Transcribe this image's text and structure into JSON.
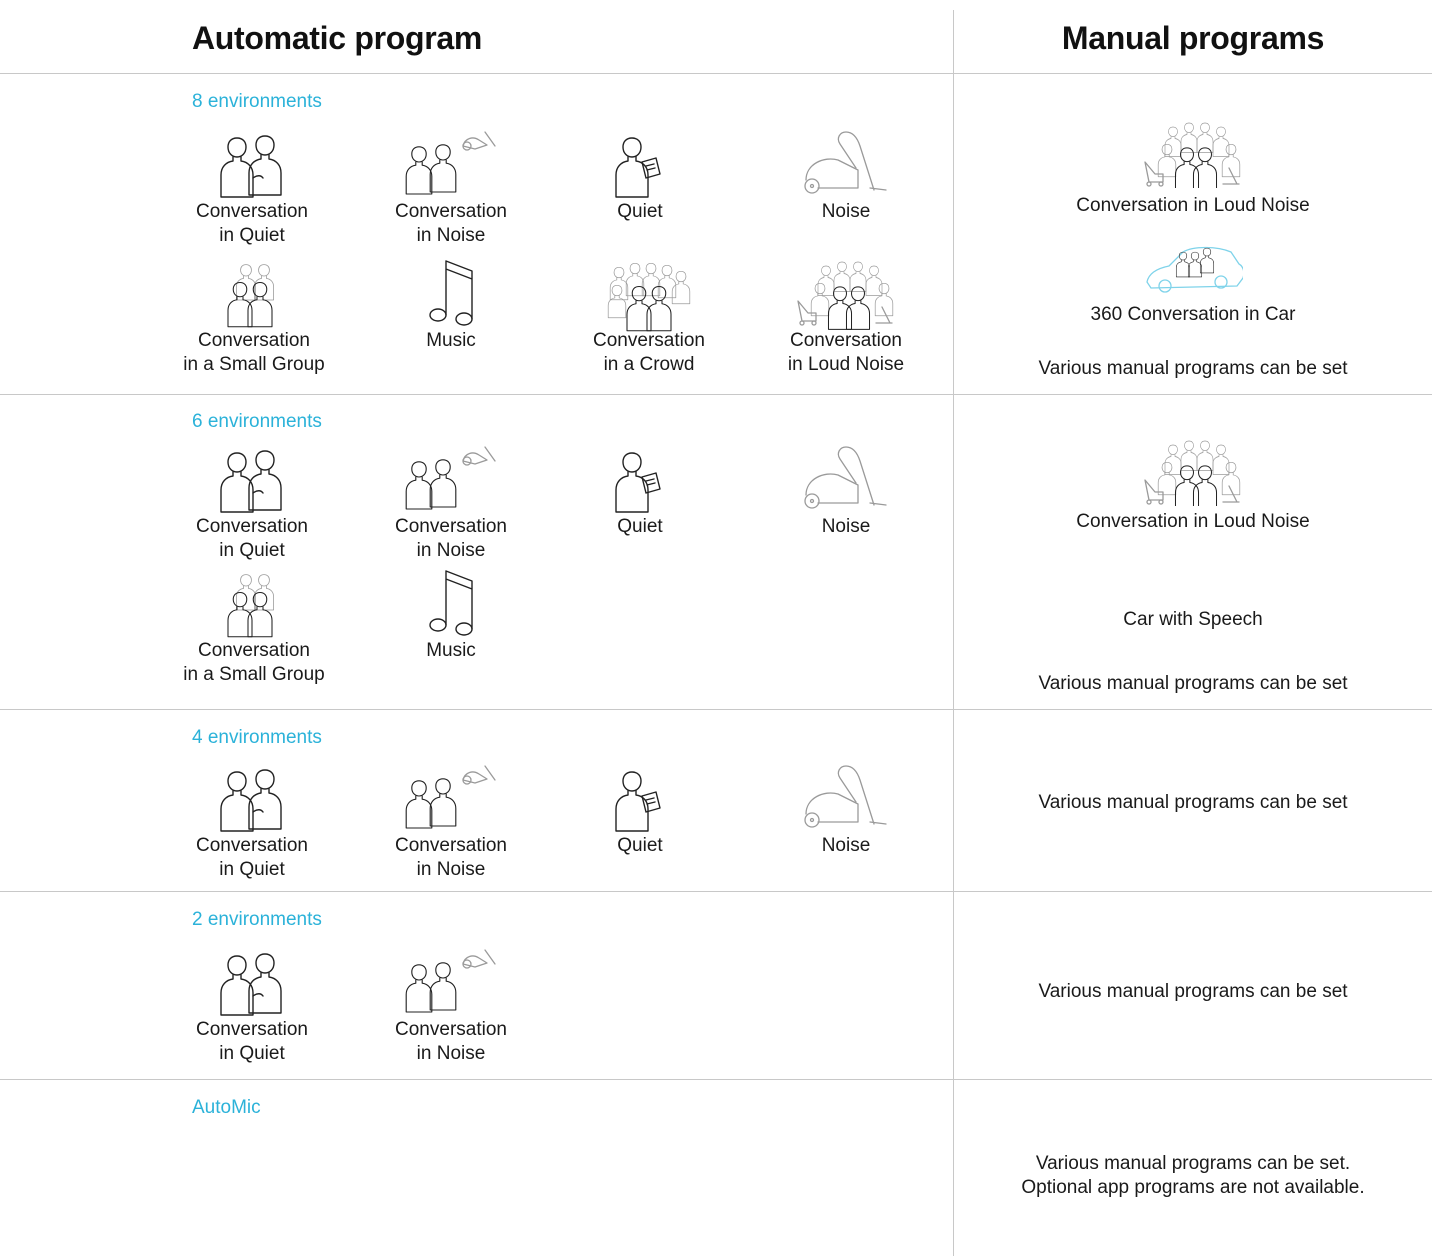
{
  "header": {
    "auto_title": "Automatic program",
    "manual_title": "Manual programs"
  },
  "rows": [
    {
      "env_label": "8 environments",
      "programs": [
        {
          "label": "Conversation\nin Quiet",
          "icon": "two-people-icon"
        },
        {
          "label": "Conversation\nin Noise",
          "icon": "two-people-noise-icon"
        },
        {
          "label": "Quiet",
          "icon": "person-reading-icon"
        },
        {
          "label": "Noise",
          "icon": "vacuum-cleaner-icon"
        },
        {
          "label": "Conversation\nin a Small Group",
          "icon": "small-group-icon"
        },
        {
          "label": "Music",
          "icon": "music-note-icon"
        },
        {
          "label": "Conversation\nin a Crowd",
          "icon": "crowd-icon"
        },
        {
          "label": "Conversation\nin Loud Noise",
          "icon": "crowd-loud-noise-icon"
        }
      ],
      "manual": [
        {
          "label": "Conversation in Loud Noise",
          "icon": "crowd-loud-noise-icon"
        },
        {
          "label": "360 Conversation in Car",
          "icon": "car-conversation-icon"
        },
        {
          "label": "Various manual programs can be set"
        }
      ]
    },
    {
      "env_label": "6 environments",
      "programs": [
        {
          "label": "Conversation\nin Quiet",
          "icon": "two-people-icon"
        },
        {
          "label": "Conversation\nin Noise",
          "icon": "two-people-noise-icon"
        },
        {
          "label": "Quiet",
          "icon": "person-reading-icon"
        },
        {
          "label": "Noise",
          "icon": "vacuum-cleaner-icon"
        },
        {
          "label": "Conversation\nin a Small Group",
          "icon": "small-group-icon"
        },
        {
          "label": "Music",
          "icon": "music-note-icon"
        }
      ],
      "manual": [
        {
          "label": "Conversation in Loud Noise",
          "icon": "crowd-loud-noise-icon"
        },
        {
          "label": "Car with Speech"
        },
        {
          "label": "Various manual programs can be set"
        }
      ]
    },
    {
      "env_label": "4 environments",
      "programs": [
        {
          "label": "Conversation\nin Quiet",
          "icon": "two-people-icon"
        },
        {
          "label": "Conversation\nin Noise",
          "icon": "two-people-noise-icon"
        },
        {
          "label": "Quiet",
          "icon": "person-reading-icon"
        },
        {
          "label": "Noise",
          "icon": "vacuum-cleaner-icon"
        }
      ],
      "manual": [
        {
          "label": "Various manual programs can be set"
        }
      ]
    },
    {
      "env_label": "2 environments",
      "programs": [
        {
          "label": "Conversation\nin Quiet",
          "icon": "two-people-icon"
        },
        {
          "label": "Conversation\nin Noise",
          "icon": "two-people-noise-icon"
        }
      ],
      "manual": [
        {
          "label": "Various manual programs can be set"
        }
      ]
    },
    {
      "env_label": "AutoMic",
      "programs": [],
      "manual": [
        {
          "label": "Various manual programs can be set.\nOptional app programs are not available."
        }
      ]
    }
  ],
  "colors": {
    "accent": "#2bb2d9",
    "divider": "#c8c8c8",
    "text": "#1a1a1a",
    "icon_gray": "#9a9a9a",
    "icon_car": "#7fd3ea"
  }
}
